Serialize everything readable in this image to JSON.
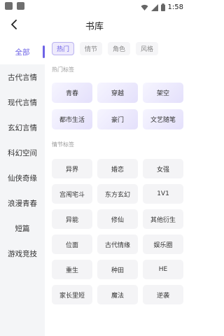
{
  "status_bar": {
    "time": "1:58"
  },
  "header": {
    "title": "书库"
  },
  "sidebar": {
    "items": [
      {
        "label": "全部"
      },
      {
        "label": "古代言情"
      },
      {
        "label": "现代言情"
      },
      {
        "label": "玄幻言情"
      },
      {
        "label": "科幻空间"
      },
      {
        "label": "仙侠奇缘"
      },
      {
        "label": "浪漫青春"
      },
      {
        "label": "短篇"
      },
      {
        "label": "游戏竞技"
      }
    ]
  },
  "tabs": [
    {
      "label": "热门"
    },
    {
      "label": "情节"
    },
    {
      "label": "角色"
    },
    {
      "label": "风格"
    }
  ],
  "hot_section": {
    "title": "热门标签",
    "tags": [
      "青春",
      "穿越",
      "架空",
      "都市生活",
      "豪门",
      "文艺随笔"
    ]
  },
  "plot_section": {
    "title": "情节标签",
    "tags": [
      "异界",
      "婚恋",
      "女强",
      "宫闱宅斗",
      "东方玄幻",
      "1V1",
      "异能",
      "修仙",
      "其他衍生",
      "位面",
      "古代情缘",
      "娱乐圈",
      "重生",
      "种田",
      "HE",
      "家长里短",
      "魔法",
      "逆袭"
    ]
  },
  "colors": {
    "accent": "#6e63e6",
    "sidebar_bg": "#f4f5f7"
  },
  "icons": {
    "back": "chevron-left-icon",
    "wifi": "wifi-icon",
    "signal": "signal-icon",
    "battery": "battery-icon"
  }
}
